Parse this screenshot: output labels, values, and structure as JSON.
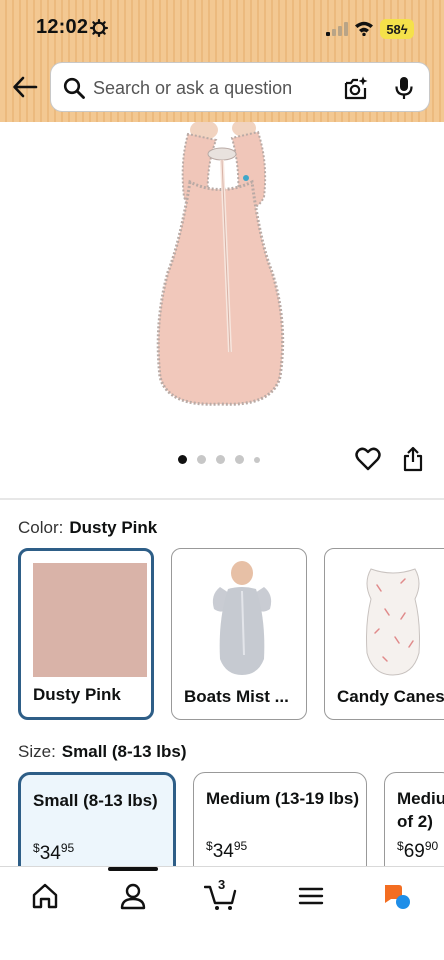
{
  "status_bar": {
    "time": "12:02",
    "battery": "58"
  },
  "search": {
    "placeholder": "Search or ask a question"
  },
  "gallery": {
    "image_count": 5,
    "active_index": 0
  },
  "color": {
    "label": "Color:",
    "selected": "Dusty Pink",
    "options": [
      {
        "name": "Dusty Pink",
        "swatch": "#d9b3a8",
        "selected": true
      },
      {
        "name": "Boats Mist ...",
        "selected": false
      },
      {
        "name": "Candy Canes",
        "selected": false
      }
    ]
  },
  "size": {
    "label": "Size:",
    "selected": "Small (8-13 lbs)",
    "options": [
      {
        "name": "Small (8-13 lbs)",
        "currency": "$",
        "price_whole": "34",
        "price_cents": "95",
        "selected": true
      },
      {
        "name": "Medium (13-19 lbs)",
        "currency": "$",
        "price_whole": "34",
        "price_cents": "95",
        "selected": false
      },
      {
        "name_line1": "Mediu",
        "name_line2": "of 2)",
        "currency": "$",
        "price_whole": "69",
        "price_cents": "90",
        "selected": false
      }
    ]
  },
  "nav": {
    "cart_count": "3",
    "items": [
      "home-icon",
      "account-icon",
      "cart-icon",
      "menu-icon",
      "rufus-icon"
    ]
  },
  "colors": {
    "accent_border": "#2e5e87",
    "header_bg": "#f3c892",
    "selected_size_bg": "#edf6fc"
  }
}
